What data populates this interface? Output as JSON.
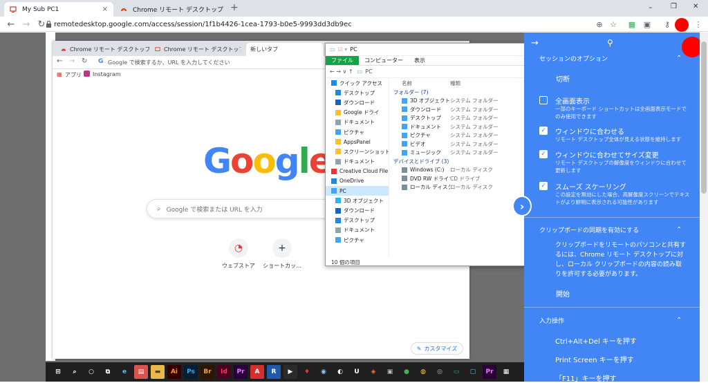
{
  "browser": {
    "tabs": [
      {
        "title": "My Sub PC1",
        "close": "×"
      },
      {
        "title": "Chrome リモート デスクトップ - Chro",
        "close": "×"
      }
    ],
    "new_tab": "+",
    "window_controls": [
      "–",
      "❐",
      "✕"
    ],
    "url": "remotedesktop.google.com/access/session/1f1b4426-1cea-1793-b0e5-9993dd3db9ec"
  },
  "inner_browser": {
    "tabs": [
      {
        "title": "Chrome リモート デスクトップ - Chro"
      },
      {
        "title": "Chrome リモート デスクトップ"
      },
      {
        "title": "新しいタブ"
      }
    ],
    "omnibox_placeholder": "Google で検索するか、URL を入力してください",
    "bookmarks": [
      "アプリ",
      "Instagram"
    ],
    "logo": {
      "G": "G",
      "o1": "o",
      "o2": "o",
      "g": "g",
      "l": "l",
      "e": "e"
    },
    "search_placeholder": "Google で検索または URL を入力",
    "shortcuts": [
      {
        "label": "ウェブストア",
        "icon": "◔"
      },
      {
        "label": "ショートカッ...",
        "icon": "+"
      }
    ],
    "customize": "カスタマイズ"
  },
  "explorer": {
    "title": "PC",
    "ribbon": [
      "ファイル",
      "コンピューター",
      "表示"
    ],
    "address": "PC",
    "nav": [
      {
        "label": "クイック アクセス",
        "color": "#1e88e5"
      },
      {
        "label": "デスクトップ",
        "color": "#1e88e5"
      },
      {
        "label": "ダウンロード",
        "color": "#1565c0"
      },
      {
        "label": "Google ドライ",
        "color": "#fbc02d"
      },
      {
        "label": "ドキュメント",
        "color": "#90a4ae"
      },
      {
        "label": "ピクチャ",
        "color": "#42a5f5"
      },
      {
        "label": "AppsPanel",
        "color": "#fbc02d"
      },
      {
        "label": "スクリーンショット",
        "color": "#fbc02d"
      },
      {
        "label": "ドキュメント",
        "color": "#90a4ae"
      },
      {
        "label": "Creative Cloud File",
        "color": "#e53935"
      },
      {
        "label": "OneDrive",
        "color": "#1e88e5"
      },
      {
        "label": "PC",
        "color": "#42a5f5"
      },
      {
        "label": "3D オブジェクト",
        "color": "#29b6f6"
      },
      {
        "label": "ダウンロード",
        "color": "#1565c0"
      },
      {
        "label": "デスクトップ",
        "color": "#1e88e5"
      },
      {
        "label": "ドキュメント",
        "color": "#90a4ae"
      },
      {
        "label": "ピクチャ",
        "color": "#42a5f5"
      }
    ],
    "columns": {
      "name": "名前",
      "type": "種類"
    },
    "folders_header": "フォルダー (7)",
    "folders": [
      {
        "name": "3D オブジェクト",
        "type": "システム フォルダー"
      },
      {
        "name": "ダウンロード",
        "type": "システム フォルダー"
      },
      {
        "name": "デスクトップ",
        "type": "システム フォルダー"
      },
      {
        "name": "ドキュメント",
        "type": "システム フォルダー"
      },
      {
        "name": "ピクチャ",
        "type": "システム フォルダー"
      },
      {
        "name": "ビデオ",
        "type": "システム フォルダー"
      },
      {
        "name": "ミュージック",
        "type": "システム フォルダー"
      }
    ],
    "drives_header": "デバイスとドライブ (3)",
    "drives": [
      {
        "name": "Windows (C:)",
        "type": "ローカル ディスク"
      },
      {
        "name": "DVD RW ドライブ (",
        "type": "CD ドライブ"
      },
      {
        "name": "ローカル ディスク (E:)",
        "type": "ローカル ディスク"
      }
    ],
    "status": "10 個の項目"
  },
  "taskbar": {
    "items": [
      {
        "label": "⊞",
        "bg": "#1f1f1f",
        "fg": "#ffffff"
      },
      {
        "label": "⌕",
        "bg": "#1f1f1f",
        "fg": "#ffffff"
      },
      {
        "label": "○",
        "bg": "#1f1f1f",
        "fg": "#ffffff"
      },
      {
        "label": "⧉",
        "bg": "#1f1f1f",
        "fg": "#ffffff"
      },
      {
        "label": "e",
        "bg": "#1f1f1f",
        "fg": "#4fc3f7"
      },
      {
        "label": "▤",
        "bg": "#d9534f",
        "fg": "#ffffff"
      },
      {
        "label": "▬",
        "bg": "#e8b84a",
        "fg": "#5a3e00"
      },
      {
        "label": "Ai",
        "bg": "#330000",
        "fg": "#ff9a00"
      },
      {
        "label": "Ps",
        "bg": "#001e36",
        "fg": "#31a8ff"
      },
      {
        "label": "Br",
        "bg": "#2c1600",
        "fg": "#e8a33b"
      },
      {
        "label": "Id",
        "bg": "#49021f",
        "fg": "#ff3366"
      },
      {
        "label": "Pr",
        "bg": "#2a0038",
        "fg": "#ea77ff"
      },
      {
        "label": "A",
        "bg": "#d32f2f",
        "fg": "#ffffff"
      },
      {
        "label": "R",
        "bg": "#1e5aa8",
        "fg": "#ffffff"
      },
      {
        "label": "▶",
        "bg": "#2b2b2b",
        "fg": "#ffffff"
      },
      {
        "label": "♦",
        "bg": "#1f1f1f",
        "fg": "#e53935"
      },
      {
        "label": "◉",
        "bg": "#1f1f1f",
        "fg": "#90caf9"
      },
      {
        "label": "◐",
        "bg": "#1f1f1f",
        "fg": "#ffffff"
      },
      {
        "label": "U",
        "bg": "#1f1f1f",
        "fg": "#ffffff"
      },
      {
        "label": "◈",
        "bg": "#1f1f1f",
        "fg": "#ff7043"
      },
      {
        "label": "▣",
        "bg": "#1f1f1f",
        "fg": "#bdbdbd"
      },
      {
        "label": "●",
        "bg": "#1f1f1f",
        "fg": "#4caf50"
      },
      {
        "label": "◍",
        "bg": "#1f1f1f",
        "fg": "#fdd835"
      },
      {
        "label": "◎",
        "bg": "#1f1f1f",
        "fg": "#bdbdbd"
      },
      {
        "label": "▭",
        "bg": "#1f1f1f",
        "fg": "#26a69a"
      },
      {
        "label": "▢",
        "bg": "#1f1f1f",
        "fg": "#4fc3f7"
      },
      {
        "label": "Pr",
        "bg": "#2a0038",
        "fg": "#ea77ff"
      },
      {
        "label": "▦",
        "bg": "#1f1f1f",
        "fg": "#ffffff"
      }
    ]
  },
  "panel": {
    "session_title": "セッションのオプション",
    "disconnect": "切断",
    "options": [
      {
        "label": "全画面表示",
        "desc": "一部のキーボード ショートカットは全画面表示モードでのみ使用できます",
        "checked": false
      },
      {
        "label": "ウィンドウに合わせる",
        "desc": "リモート デスクトップ全体が見える状態を維持します",
        "checked": true
      },
      {
        "label": "ウィンドウに合わせてサイズ変更",
        "desc": "リモート デスクトップの解像度をウィンドウに合わせて更新します",
        "checked": true
      },
      {
        "label": "スムーズ スケーリング",
        "desc": "この設定を無効にした場合、高解像度スクリーンでテキストがより鮮明に表示される可能性があります",
        "checked": true
      }
    ],
    "clipboard_title": "クリップボードの同期を有効にする",
    "clipboard_text": "クリップボードをリモートのパソコンと共有するには、Chrome リモート デスクトップに対し、ローカル クリップボードの内容の読み取りを許可する必要があります。",
    "start": "開始",
    "input_title": "入力操作",
    "input_actions": [
      "Ctrl+Alt+Del キーを押す",
      "Print Screen キーを押す",
      "「F11」キーを押す"
    ],
    "check_mark": "✓",
    "chevron": "⌃",
    "arrow": "→",
    "pin": "⚲",
    "collapse": "›"
  },
  "colors": {
    "panel_blue": "#4285f4",
    "record_red": "#ff0000",
    "google_blue": "#4285f4",
    "google_red": "#ea4335",
    "google_yellow": "#fbbc05",
    "google_green": "#34a853"
  }
}
